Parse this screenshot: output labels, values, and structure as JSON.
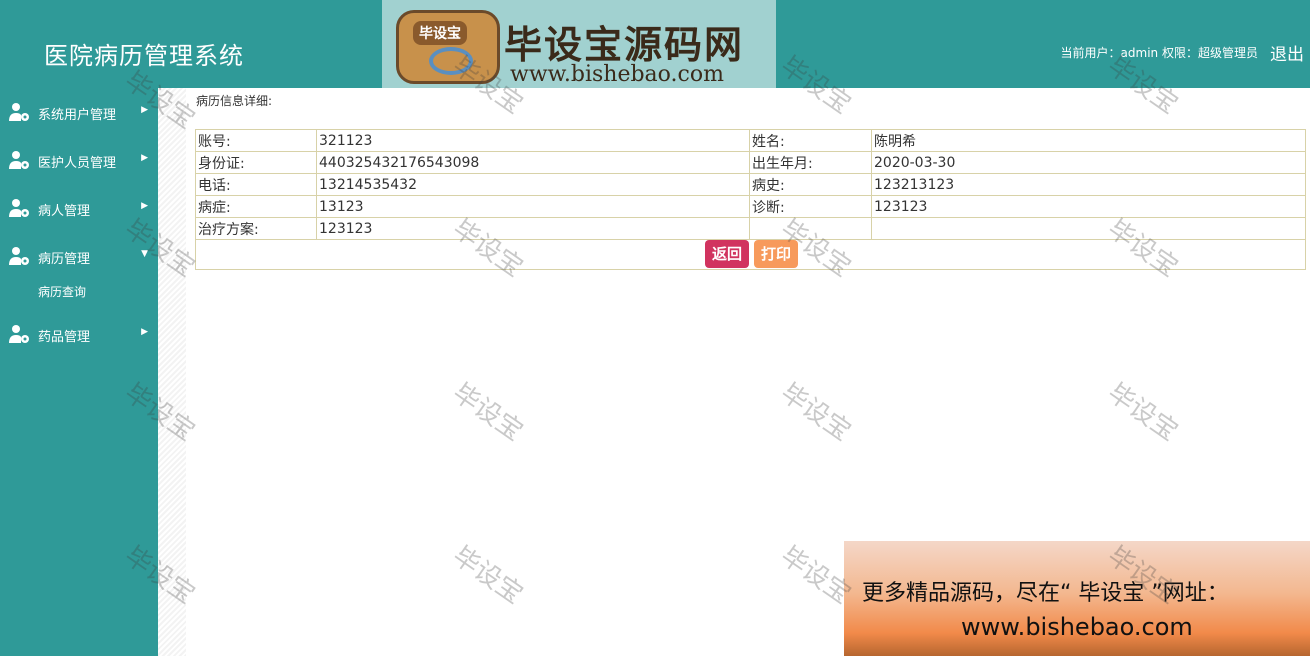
{
  "header": {
    "app_title": "医院病历管理系统",
    "current_user_label": "当前用户：",
    "current_user": "admin",
    "permission_label": "权限：",
    "permission": "超级管理员",
    "logout_label": "退出"
  },
  "watermark": {
    "logo_text": "毕设宝",
    "brand": "毕设宝源码网",
    "url": "www.bishebao.com",
    "overlay_text": "毕设宝"
  },
  "sidebar": {
    "items": [
      {
        "label": "系统用户管理",
        "icon": "user-gear-icon",
        "caret": "▶"
      },
      {
        "label": "医护人员管理",
        "icon": "user-gear-icon",
        "caret": "▶"
      },
      {
        "label": "病人管理",
        "icon": "user-gear-icon",
        "caret": "▶"
      },
      {
        "label": "病历管理",
        "icon": "user-gear-icon",
        "caret": "▼"
      },
      {
        "label": "药品管理",
        "icon": "user-gear-icon",
        "caret": "▶"
      }
    ],
    "submenu": [
      {
        "label": "病历查询"
      }
    ]
  },
  "content": {
    "title": "病历信息详细:",
    "rows": [
      {
        "label1": "账号:",
        "value1": "321123",
        "label2": "姓名:",
        "value2": "陈明希"
      },
      {
        "label1": "身份证:",
        "value1": "440325432176543098",
        "label2": "出生年月:",
        "value2": "2020-03-30"
      },
      {
        "label1": "电话:",
        "value1": "13214535432",
        "label2": "病史:",
        "value2": "123213123"
      },
      {
        "label1": "病症:",
        "value1": "13123",
        "label2": "诊断:",
        "value2": "123123"
      },
      {
        "label1": "治疗方案:",
        "value1": "123123",
        "label2": "",
        "value2": ""
      }
    ],
    "back_button": "返回",
    "print_button": "打印"
  },
  "banner": {
    "line1": "更多精品源码，尽在“ 毕设宝 ”网址：",
    "line2": "www.bishebao.com"
  },
  "colors": {
    "theme": "#2f9a98",
    "back_button": "#d1335f",
    "print_button": "#f79a5c",
    "table_border": "#d8d2a8"
  }
}
